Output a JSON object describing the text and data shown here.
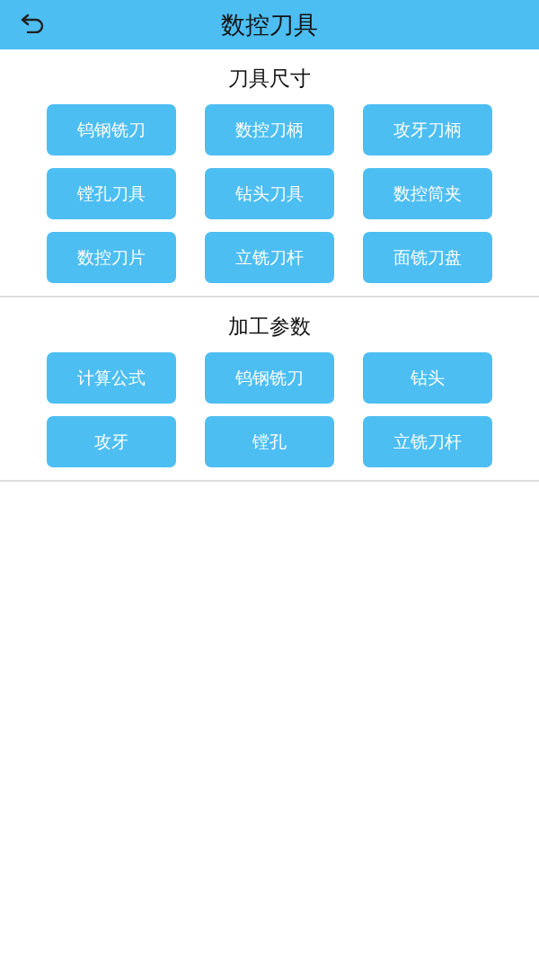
{
  "header": {
    "title": "数控刀具"
  },
  "sections": [
    {
      "title": "刀具尺寸",
      "buttons": [
        "钨钢铣刀",
        "数控刀柄",
        "攻牙刀柄",
        "镗孔刀具",
        "钻头刀具",
        "数控筒夹",
        "数控刀片",
        "立铣刀杆",
        "面铣刀盘"
      ]
    },
    {
      "title": "加工参数",
      "buttons": [
        "计算公式",
        "钨钢铣刀",
        "钻头",
        "攻牙",
        "镗孔",
        "立铣刀杆"
      ]
    }
  ]
}
